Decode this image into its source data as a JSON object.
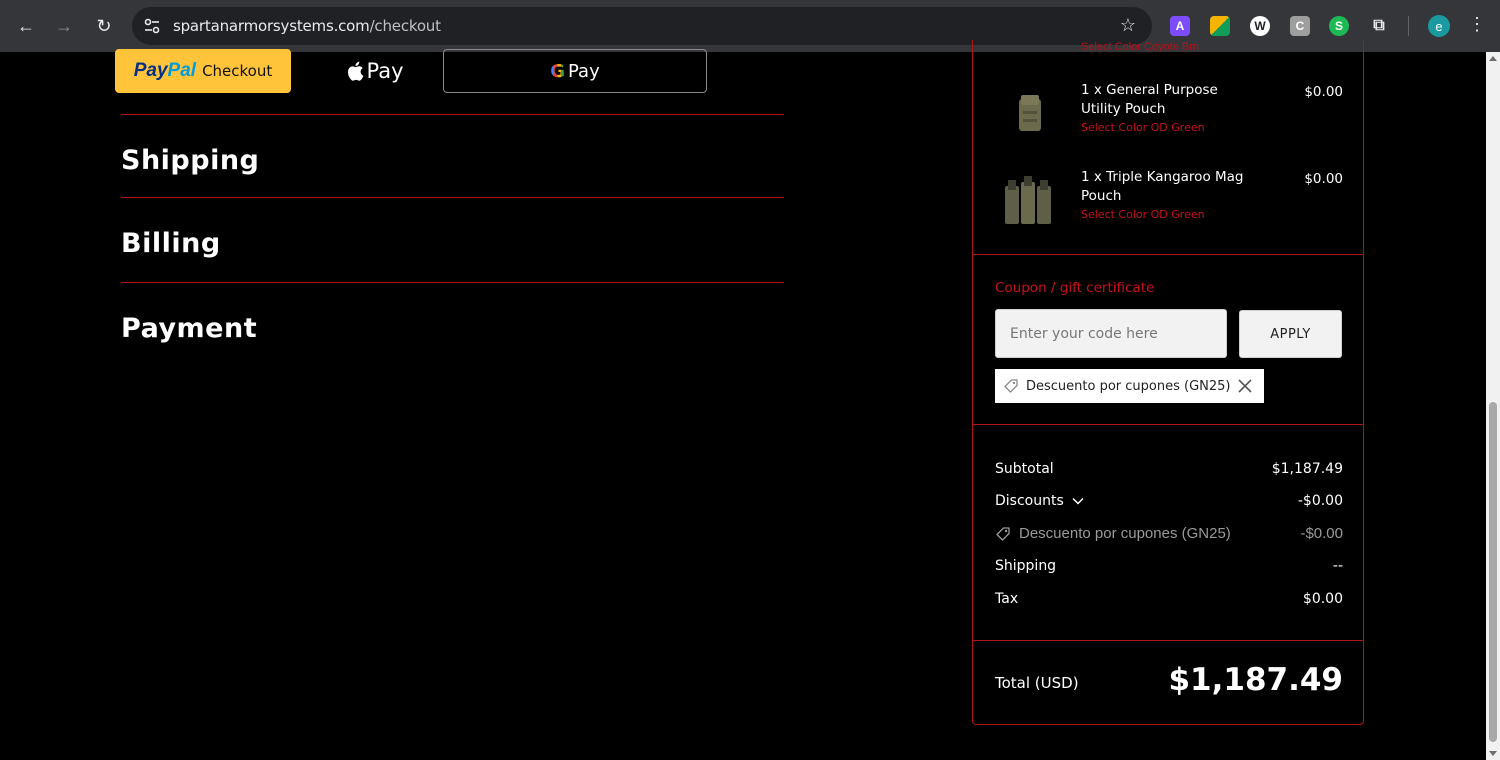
{
  "browser": {
    "url_host": "spartanarmorsystems.com",
    "url_path": "/checkout",
    "extensions": [
      {
        "name": "a-extension-icon",
        "letter": "A",
        "color": "#7c4dff"
      },
      {
        "name": "grid-extension-icon",
        "letter": "",
        "color": "#f4b400"
      },
      {
        "name": "w-extension-icon",
        "letter": "W",
        "color": "#202124"
      },
      {
        "name": "c-extension-icon",
        "letter": "C",
        "color": "#9e9e9e"
      },
      {
        "name": "s-extension-icon",
        "letter": "S",
        "color": "#1db954"
      }
    ],
    "profile_initial": "e"
  },
  "express_checkout": {
    "paypal_pay": "Pay",
    "paypal_pal": "Pal",
    "paypal_checkout": "Checkout",
    "applepay_label": "Pay",
    "gpay_g": "G",
    "gpay_label": "Pay"
  },
  "sections": {
    "shipping": "Shipping",
    "billing": "Billing",
    "payment": "Payment"
  },
  "summary": {
    "cut_text": "Select Color Coyote Brn",
    "items": [
      {
        "name": "1 x General Purpose Utility Pouch",
        "option": "Select Color OD Green",
        "price": "$0.00"
      },
      {
        "name": "1 x Triple Kangaroo Mag Pouch",
        "option": "Select Color OD Green",
        "price": "$0.00"
      }
    ],
    "coupon_label": "Coupon / gift certificate",
    "coupon_placeholder": "Enter your code here",
    "apply_label": "APPLY",
    "applied_coupon": "Descuento por cupones (GN25)",
    "subtotal_label": "Subtotal",
    "subtotal_value": "$1,187.49",
    "discounts_label": "Discounts",
    "discounts_value": "-$0.00",
    "discount_detail_label": "Descuento por cupones (GN25)",
    "discount_detail_value": "-$0.00",
    "shipping_label": "Shipping",
    "shipping_value": "--",
    "tax_label": "Tax",
    "tax_value": "$0.00",
    "total_label": "Total (USD)",
    "total_value": "$1,187.49"
  },
  "colors": {
    "accent_red": "#b0141b",
    "paypal_yellow": "#ffc439"
  }
}
